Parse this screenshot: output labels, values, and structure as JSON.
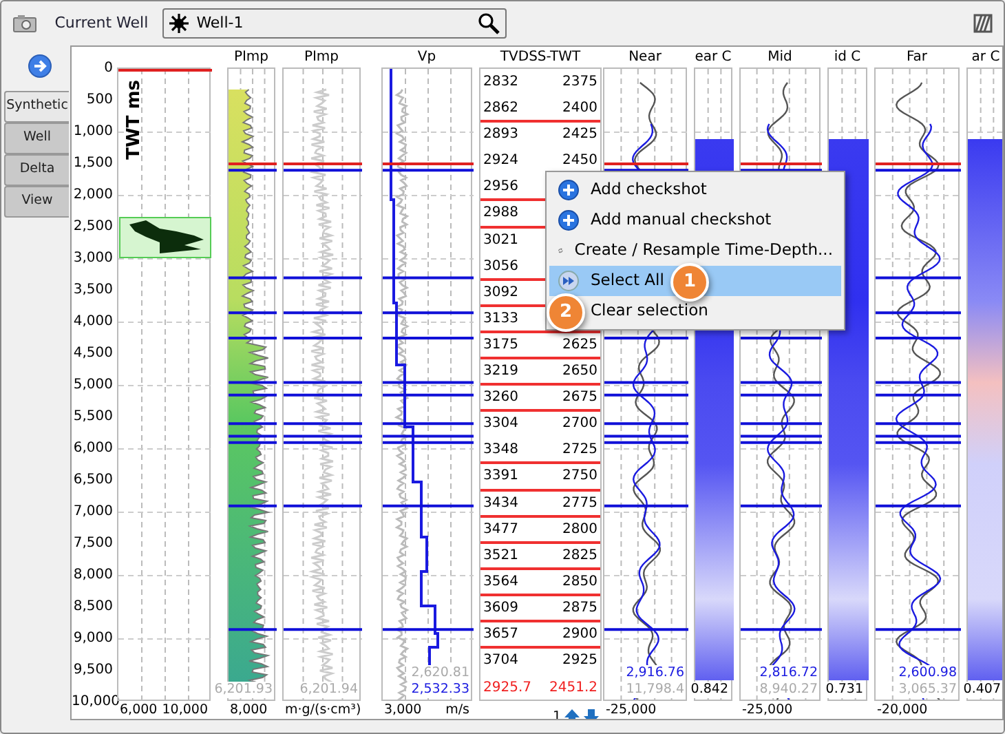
{
  "toolbar": {
    "label": "Current Well",
    "well": "Well-1"
  },
  "side_tabs": [
    {
      "label": "Synthetic",
      "selected": true
    },
    {
      "label": "Well",
      "selected": false
    },
    {
      "label": "Delta",
      "selected": false
    },
    {
      "label": "View",
      "selected": false
    }
  ],
  "axis": {
    "title": "TWT ms",
    "ticks": [
      "0",
      "500",
      "1,000",
      "1,500",
      "2,000",
      "2,500",
      "3,000",
      "3,500",
      "4,000",
      "4,500",
      "5,000",
      "5,500",
      "6,000",
      "6,500",
      "7,000",
      "7,500",
      "8,000",
      "8,500",
      "9,000",
      "9,500",
      "10,000"
    ]
  },
  "tracks": [
    {
      "kind": "lithology",
      "footer": [
        "6,000",
        "10,000"
      ]
    },
    {
      "kind": "impedance",
      "header": "PImp",
      "values": [
        {
          "text": "6,201.93",
          "kind": "reference"
        }
      ],
      "footer": [
        "8,000"
      ]
    },
    {
      "kind": "curve",
      "header": "PImp",
      "values": [
        {
          "text": "6,201.94",
          "kind": "reference"
        }
      ],
      "footer": [
        "m·g/(s·cm³)"
      ]
    },
    {
      "kind": "velocity",
      "header": "Vp",
      "values": [
        {
          "text": "2,620.81",
          "kind": "reference"
        },
        {
          "text": "2,532.33",
          "kind": "current"
        }
      ],
      "footer": [
        "3,000",
        "m/s"
      ]
    },
    {
      "kind": "time-depth",
      "header": "TVDSS-TWT",
      "rows": [
        {
          "tvdss": "2832",
          "twt": "2375",
          "marked": false
        },
        {
          "tvdss": "2862",
          "twt": "2400",
          "marked": true
        },
        {
          "tvdss": "2893",
          "twt": "2425",
          "marked": false
        },
        {
          "tvdss": "2924",
          "twt": "2450",
          "marked": false
        },
        {
          "tvdss": "2956",
          "marked": true
        },
        {
          "tvdss": "2988",
          "marked": true
        },
        {
          "tvdss": "3021",
          "marked": false
        },
        {
          "tvdss": "3056",
          "marked": true
        },
        {
          "tvdss": "3092",
          "marked": true
        },
        {
          "tvdss": "3133",
          "marked": true
        },
        {
          "tvdss": "3175",
          "twt": "2625",
          "marked": true
        },
        {
          "tvdss": "3219",
          "twt": "2650",
          "marked": true
        },
        {
          "tvdss": "3260",
          "twt": "2675",
          "marked": true
        },
        {
          "tvdss": "3304",
          "twt": "2700",
          "marked": false
        },
        {
          "tvdss": "3348",
          "twt": "2725",
          "marked": true
        },
        {
          "tvdss": "3391",
          "twt": "2750",
          "marked": true
        },
        {
          "tvdss": "3434",
          "twt": "2775",
          "marked": true
        },
        {
          "tvdss": "3477",
          "twt": "2800",
          "marked": true
        },
        {
          "tvdss": "3521",
          "twt": "2825",
          "marked": true
        },
        {
          "tvdss": "3564",
          "twt": "2850",
          "marked": true
        },
        {
          "tvdss": "3609",
          "twt": "2875",
          "marked": true
        },
        {
          "tvdss": "3657",
          "twt": "2900",
          "marked": true
        },
        {
          "tvdss": "3704",
          "twt": "2925",
          "marked": false
        }
      ],
      "totals": [
        "2925.7",
        "2451.2"
      ],
      "page": "1"
    },
    {
      "kind": "trace",
      "header": "Near",
      "values": [
        {
          "text": "2,916.76",
          "kind": "current"
        },
        {
          "text": "11,798.4",
          "kind": "reference"
        }
      ],
      "footer": [
        "-25,000"
      ]
    },
    {
      "kind": "amplitude",
      "header": "ear C",
      "values": [
        {
          "text": "0.842",
          "kind": "value"
        }
      ]
    },
    {
      "kind": "trace",
      "header": "Mid",
      "values": [
        {
          "text": "2,816.72",
          "kind": "current"
        },
        {
          "text": "8,940.27",
          "kind": "reference"
        }
      ],
      "footer": [
        "-25,000"
      ]
    },
    {
      "kind": "amplitude",
      "header": "id C",
      "values": [
        {
          "text": "0.731",
          "kind": "value"
        }
      ]
    },
    {
      "kind": "trace",
      "header": "Far",
      "values": [
        {
          "text": "2,600.98",
          "kind": "current"
        },
        {
          "text": "3,065.37",
          "kind": "reference"
        }
      ],
      "footer": [
        "-20,000"
      ]
    },
    {
      "kind": "amplitude",
      "header": "ar C",
      "values": [
        {
          "text": "0.407",
          "kind": "value"
        }
      ]
    }
  ],
  "context_menu": {
    "items": [
      {
        "label": "Add checkshot",
        "selected": false
      },
      {
        "label": "Add manual checkshot",
        "selected": false
      },
      {
        "label": "Create / Resample Time-Depth...",
        "selected": false
      },
      {
        "label": "Select All",
        "selected": true
      },
      {
        "label": "Clear selection",
        "selected": false
      }
    ]
  },
  "callouts": [
    "1",
    "2"
  ]
}
